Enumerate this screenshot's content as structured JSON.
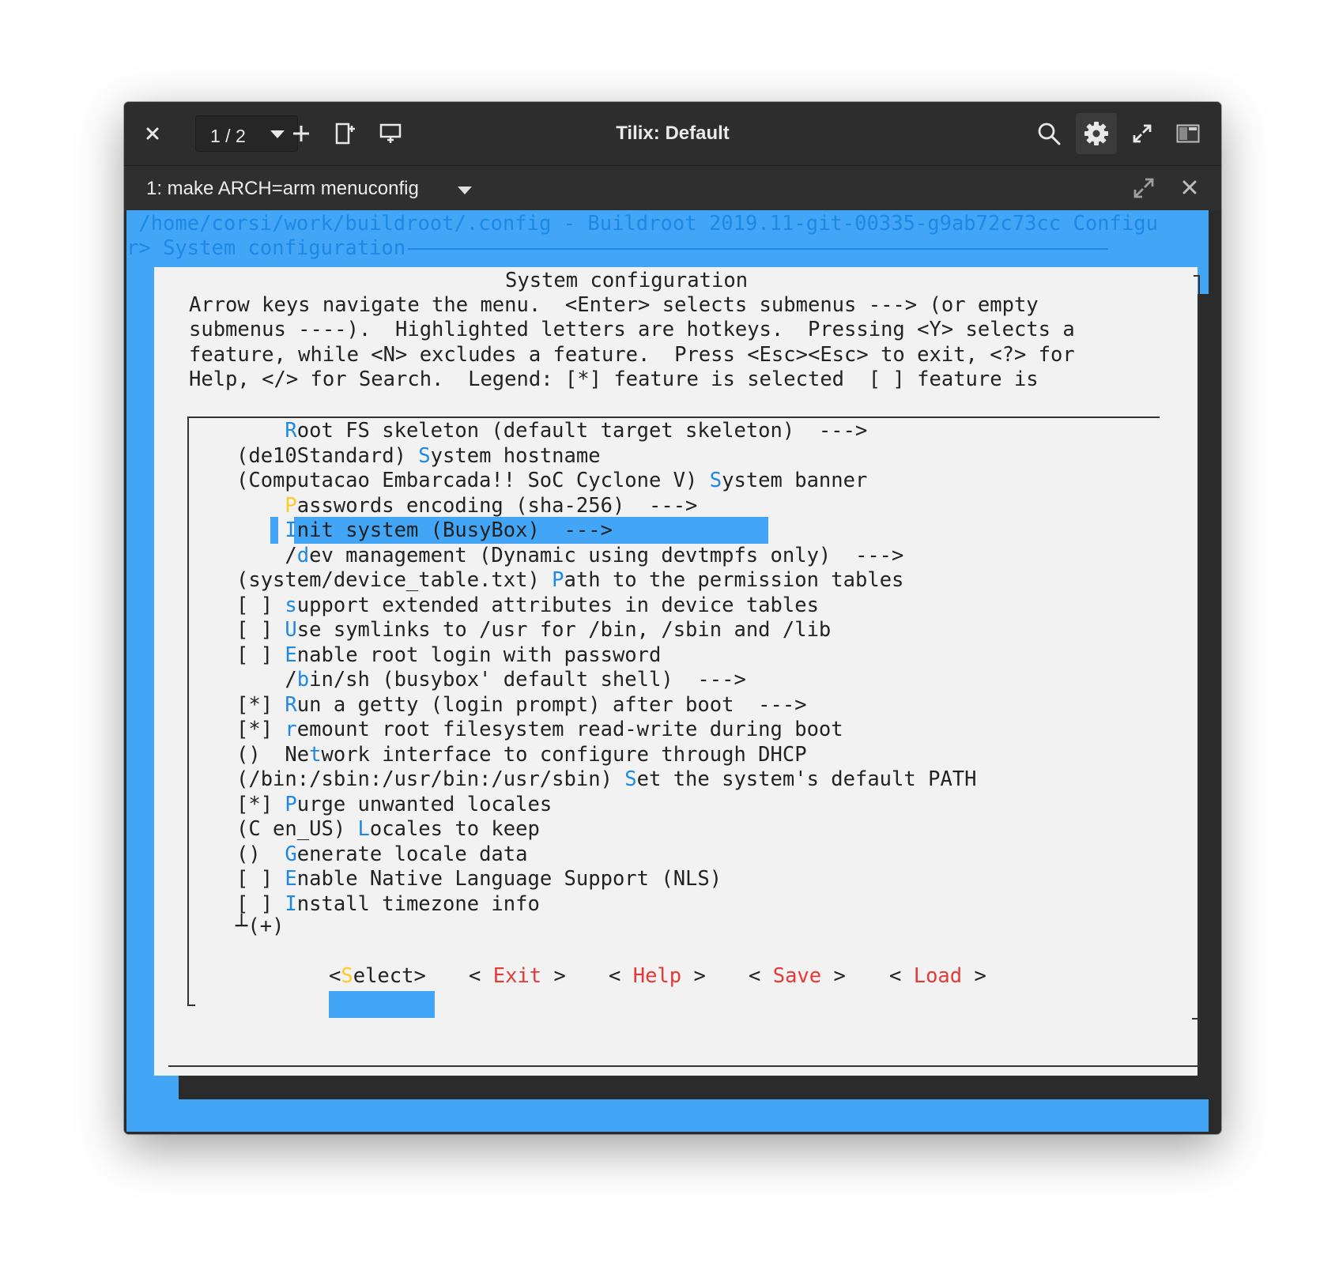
{
  "window": {
    "title": "Tilix: Default",
    "session_indicator": "1 / 2",
    "tab_title": "1: make ARCH=arm menuconfig"
  },
  "colors": {
    "terminal_blue": "#42a5f5",
    "header_text": "#1e88e5",
    "dialog_bg": "#f2f2f2",
    "hotkey": "#1e88e5",
    "hotkey_selected": "#ffca28",
    "button_hotkey": "#e53935",
    "more_indicator": "#c0ca33"
  },
  "icons": {
    "close": "close-icon",
    "session_dropdown": "chevron-down-icon",
    "add_terminal": "plus-icon",
    "add_right": "split-right-icon",
    "add_down": "split-down-icon",
    "search": "search-icon",
    "settings": "gear-icon",
    "fullscreen": "maximize-icon",
    "sidebar": "sidebar-icon",
    "tab_maximize": "maximize-icon",
    "tab_close": "close-icon"
  },
  "terminal": {
    "header_line1": " /home/corsi/work/buildroot/.config - Buildroot 2019.11-git-00335-g9ab72c73cc Configu",
    "header_line2_prefix": "r> ",
    "header_line2_title": "System configuration",
    "dialog": {
      "title": "System configuration",
      "help_lines": [
        "Arrow keys navigate the menu.  <Enter> selects submenus ---> (or empty",
        "submenus ----).  Highlighted letters are hotkeys.  Pressing <Y> selects a",
        "feature, while <N> excludes a feature.  Press <Esc><Esc> to exit, <?> for",
        "Help, </> for Search.  Legend: [*] feature is selected  [ ] feature is"
      ],
      "items": [
        {
          "prefix": "    ",
          "hot": "R",
          "rest": "oot FS skeleton (default target skeleton)  --->"
        },
        {
          "prefix": "(de10Standard) ",
          "hot": "S",
          "rest": "ystem hostname"
        },
        {
          "prefix": "(Computacao Embarcada!! SoC Cyclone V) ",
          "hot": "S",
          "rest": "ystem banner"
        },
        {
          "prefix": "    ",
          "hot": "P",
          "rest": "asswords encoding (sha-256)  --->",
          "selected": true
        },
        {
          "prefix": "    ",
          "hot": "I",
          "rest": "nit system (BusyBox)  --->"
        },
        {
          "prefix": "    /",
          "hot": "d",
          "rest": "ev management (Dynamic using devtmpfs only)  --->"
        },
        {
          "prefix": "(system/device_table.txt) ",
          "hot": "P",
          "rest": "ath to the permission tables"
        },
        {
          "prefix": "[ ] ",
          "hot": "s",
          "rest": "upport extended attributes in device tables"
        },
        {
          "prefix": "[ ] ",
          "hot": "U",
          "rest": "se symlinks to /usr for /bin, /sbin and /lib"
        },
        {
          "prefix": "[ ] ",
          "hot": "E",
          "rest": "nable root login with password"
        },
        {
          "prefix": "    /",
          "hot": "b",
          "rest": "in/sh (busybox' default shell)  --->"
        },
        {
          "prefix": "[*] ",
          "hot": "R",
          "rest": "un a getty (login prompt) after boot  --->"
        },
        {
          "prefix": "[*] ",
          "hot": "r",
          "rest": "emount root filesystem read-write during boot"
        },
        {
          "prefix": "()  ",
          "hot": "",
          "rest": "",
          "mixed_pre": "Ne",
          "mixed_hot": "t",
          "mixed_post": "work interface to configure through DHCP"
        },
        {
          "prefix": "(/bin:/sbin:/usr/bin:/usr/sbin) ",
          "hot": "S",
          "rest": "et the system's default PATH"
        },
        {
          "prefix": "[*] ",
          "hot": "P",
          "rest": "urge unwanted locales"
        },
        {
          "prefix": "(C en_US) ",
          "hot": "L",
          "rest": "ocales to keep"
        },
        {
          "prefix": "()  ",
          "hot": "G",
          "rest": "enerate locale data"
        },
        {
          "prefix": "[ ] ",
          "hot": "E",
          "rest": "nable Native Language Support (NLS)"
        },
        {
          "prefix": "[ ] ",
          "hot": "I",
          "rest": "nstall timezone info"
        }
      ],
      "more_indicator": "(+)",
      "buttons": [
        {
          "open": "<",
          "hot": "S",
          "rest": "elect",
          "close": ">",
          "selected": true
        },
        {
          "open": "< ",
          "hot": "E",
          "rest": "xit",
          "close": " >"
        },
        {
          "open": "< ",
          "hot": "H",
          "rest": "elp",
          "close": " >"
        },
        {
          "open": "< ",
          "hot": "S",
          "rest": "ave",
          "close": " >"
        },
        {
          "open": "< ",
          "hot": "L",
          "rest": "oad",
          "close": " >"
        }
      ]
    }
  }
}
